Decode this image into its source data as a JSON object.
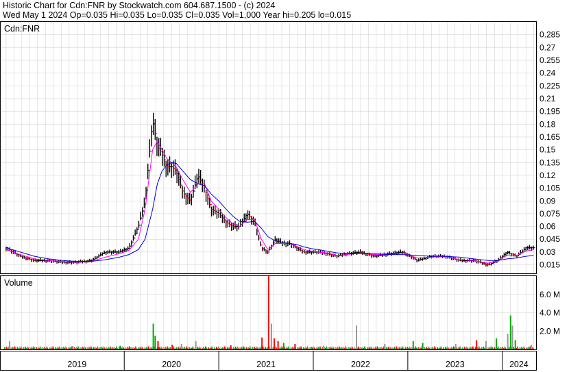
{
  "header": {
    "line1": "Historic Chart for Cdn:FNR by Stockwatch.com 604.687.1500 - (c) 2024",
    "line2": "Wed May  1 2024   Op=0.035  Hi=0.035  Lo=0.035  Cl=0.035  Vol=1,000  Year hi=0.205  lo=0.015"
  },
  "colors": {
    "price_bar": "#000000",
    "down_tick": "#ff0000",
    "ma_short": "#ff00ff",
    "ma_long": "#0000cc",
    "volume_up": "#00aa00",
    "volume_down": "#ff0000",
    "volume_flat": "#999999",
    "grid": "#cccccc",
    "frame": "#000000"
  },
  "chart_data": [
    {
      "type": "line",
      "panel": "price",
      "symbol_label": "Cdn:FNR",
      "ylim": [
        0.005,
        0.3
      ],
      "yticks": [
        0.015,
        0.03,
        0.045,
        0.06,
        0.075,
        0.09,
        0.105,
        0.12,
        0.135,
        0.15,
        0.165,
        0.18,
        0.195,
        0.21,
        0.225,
        0.24,
        0.255,
        0.27,
        0.285
      ],
      "ytick_labels": [
        "0.015",
        "0.03",
        "0.045",
        "0.06",
        "0.075",
        "0.09",
        "0.105",
        "0.12",
        "0.135",
        "0.15",
        "0.165",
        "0.18",
        "0.195",
        "0.21",
        "0.225",
        "0.24",
        "0.255",
        "0.27",
        "0.285"
      ],
      "grid": true,
      "x": [
        2018.75,
        2018.9,
        2019.05,
        2019.2,
        2019.35,
        2019.5,
        2019.65,
        2019.8,
        2019.95,
        2020.05,
        2020.15,
        2020.22,
        2020.3,
        2020.35,
        2020.4,
        2020.45,
        2020.5,
        2020.55,
        2020.62,
        2020.7,
        2020.78,
        2020.85,
        2020.92,
        2021.0,
        2021.08,
        2021.15,
        2021.22,
        2021.3,
        2021.38,
        2021.45,
        2021.52,
        2021.6,
        2021.68,
        2021.75,
        2021.82,
        2021.9,
        2021.98,
        2022.05,
        2022.15,
        2022.25,
        2022.35,
        2022.5,
        2022.65,
        2022.8,
        2022.95,
        2023.1,
        2023.25,
        2023.4,
        2023.55,
        2023.7,
        2023.85,
        2023.95,
        2024.05,
        2024.15,
        2024.25,
        2024.33
      ],
      "series": [
        {
          "role": "price_close",
          "values": [
            0.035,
            0.025,
            0.02,
            0.02,
            0.018,
            0.018,
            0.02,
            0.03,
            0.03,
            0.035,
            0.06,
            0.09,
            0.185,
            0.155,
            0.145,
            0.13,
            0.13,
            0.125,
            0.1,
            0.09,
            0.12,
            0.105,
            0.08,
            0.075,
            0.065,
            0.06,
            0.06,
            0.075,
            0.065,
            0.035,
            0.03,
            0.045,
            0.04,
            0.04,
            0.035,
            0.03,
            0.03,
            0.03,
            0.028,
            0.025,
            0.028,
            0.03,
            0.025,
            0.028,
            0.03,
            0.02,
            0.025,
            0.025,
            0.02,
            0.02,
            0.015,
            0.02,
            0.03,
            0.025,
            0.035,
            0.035
          ]
        },
        {
          "role": "ma_short",
          "values": [
            0.033,
            0.027,
            0.022,
            0.02,
            0.019,
            0.018,
            0.019,
            0.024,
            0.028,
            0.032,
            0.045,
            0.08,
            0.15,
            0.16,
            0.15,
            0.14,
            0.135,
            0.13,
            0.115,
            0.1,
            0.11,
            0.11,
            0.09,
            0.08,
            0.07,
            0.063,
            0.06,
            0.068,
            0.068,
            0.045,
            0.033,
            0.04,
            0.04,
            0.04,
            0.037,
            0.033,
            0.031,
            0.03,
            0.029,
            0.026,
            0.027,
            0.029,
            0.027,
            0.027,
            0.029,
            0.023,
            0.024,
            0.025,
            0.021,
            0.02,
            0.017,
            0.019,
            0.026,
            0.026,
            0.031,
            0.033
          ]
        },
        {
          "role": "ma_long",
          "values": [
            0.035,
            0.03,
            0.025,
            0.022,
            0.02,
            0.019,
            0.019,
            0.021,
            0.024,
            0.027,
            0.033,
            0.045,
            0.08,
            0.11,
            0.125,
            0.132,
            0.135,
            0.134,
            0.125,
            0.115,
            0.11,
            0.108,
            0.098,
            0.09,
            0.08,
            0.072,
            0.066,
            0.065,
            0.066,
            0.058,
            0.048,
            0.043,
            0.041,
            0.04,
            0.039,
            0.036,
            0.034,
            0.033,
            0.031,
            0.029,
            0.028,
            0.028,
            0.028,
            0.027,
            0.027,
            0.026,
            0.025,
            0.025,
            0.024,
            0.022,
            0.02,
            0.02,
            0.022,
            0.023,
            0.025,
            0.026
          ]
        }
      ]
    },
    {
      "type": "bar",
      "panel": "volume",
      "title": "Volume",
      "ylim": [
        0,
        8000000
      ],
      "yticks": [
        2000000,
        4000000,
        6000000
      ],
      "ytick_labels": [
        "2.0 M",
        "4.0 M",
        "6.0 M"
      ],
      "x_range": [
        2018.7,
        2024.35
      ],
      "x_axis_labels": [
        {
          "label": "2019",
          "year": 2019
        },
        {
          "label": "2020",
          "year": 2020
        },
        {
          "label": "2021",
          "year": 2021
        },
        {
          "label": "2022",
          "year": 2022
        },
        {
          "label": "2023",
          "year": 2023
        },
        {
          "label": "2024",
          "year": 2024
        }
      ],
      "bars": [
        {
          "x": 2018.78,
          "value": 900000,
          "dir": "flat"
        },
        {
          "x": 2019.45,
          "value": 350000,
          "dir": "flat"
        },
        {
          "x": 2019.95,
          "value": 400000,
          "dir": "up"
        },
        {
          "x": 2020.05,
          "value": 300000,
          "dir": "down"
        },
        {
          "x": 2020.3,
          "value": 2800000,
          "dir": "up"
        },
        {
          "x": 2020.32,
          "value": 1500000,
          "dir": "up"
        },
        {
          "x": 2020.35,
          "value": 900000,
          "dir": "down"
        },
        {
          "x": 2020.5,
          "value": 500000,
          "dir": "down"
        },
        {
          "x": 2020.6,
          "value": 600000,
          "dir": "flat"
        },
        {
          "x": 2020.75,
          "value": 900000,
          "dir": "flat"
        },
        {
          "x": 2021.12,
          "value": 450000,
          "dir": "down"
        },
        {
          "x": 2021.45,
          "value": 1300000,
          "dir": "down"
        },
        {
          "x": 2021.52,
          "value": 8000000,
          "dir": "down"
        },
        {
          "x": 2021.55,
          "value": 2800000,
          "dir": "flat"
        },
        {
          "x": 2021.58,
          "value": 1200000,
          "dir": "down"
        },
        {
          "x": 2021.62,
          "value": 900000,
          "dir": "down"
        },
        {
          "x": 2021.68,
          "value": 700000,
          "dir": "up"
        },
        {
          "x": 2021.8,
          "value": 600000,
          "dir": "down"
        },
        {
          "x": 2022.1,
          "value": 400000,
          "dir": "flat"
        },
        {
          "x": 2022.45,
          "value": 2600000,
          "dir": "flat"
        },
        {
          "x": 2022.75,
          "value": 600000,
          "dir": "flat"
        },
        {
          "x": 2023.05,
          "value": 900000,
          "dir": "up"
        },
        {
          "x": 2023.15,
          "value": 700000,
          "dir": "up"
        },
        {
          "x": 2023.5,
          "value": 600000,
          "dir": "flat"
        },
        {
          "x": 2023.72,
          "value": 1000000,
          "dir": "down"
        },
        {
          "x": 2023.82,
          "value": 900000,
          "dir": "flat"
        },
        {
          "x": 2023.93,
          "value": 1200000,
          "dir": "up"
        },
        {
          "x": 2024.05,
          "value": 1700000,
          "dir": "flat"
        },
        {
          "x": 2024.08,
          "value": 3700000,
          "dir": "up"
        },
        {
          "x": 2024.1,
          "value": 2600000,
          "dir": "flat"
        },
        {
          "x": 2024.13,
          "value": 1000000,
          "dir": "up"
        },
        {
          "x": 2024.3,
          "value": 500000,
          "dir": "flat"
        }
      ]
    }
  ]
}
